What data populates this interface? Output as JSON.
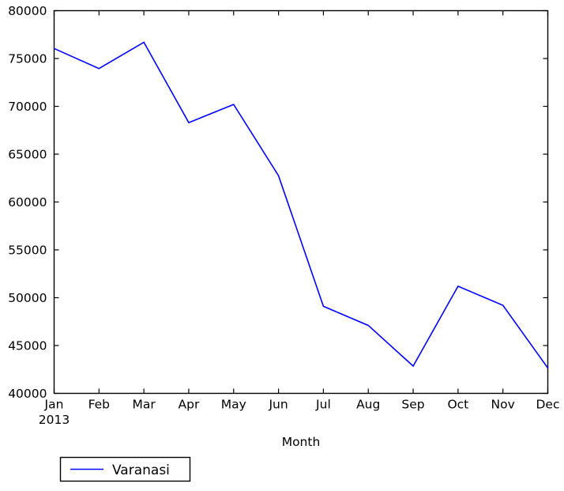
{
  "chart_data": {
    "type": "line",
    "title": "",
    "xlabel": "Month",
    "ylabel": "",
    "categories": [
      "Jan",
      "Feb",
      "Mar",
      "Apr",
      "May",
      "Jun",
      "Jul",
      "Aug",
      "Sep",
      "Oct",
      "Nov",
      "Dec"
    ],
    "x_year_label": "2013",
    "series": [
      {
        "name": "Varanasi",
        "color": "#0000ff",
        "values": [
          76050,
          73950,
          76700,
          68300,
          70200,
          62750,
          49100,
          47100,
          42850,
          51200,
          49200,
          42650
        ]
      }
    ],
    "ylim": [
      40000,
      80000
    ],
    "yticks": [
      "40000",
      "45000",
      "50000",
      "55000",
      "60000",
      "65000",
      "70000",
      "75000",
      "80000"
    ],
    "ytick_values": [
      40000,
      45000,
      50000,
      55000,
      60000,
      65000,
      70000,
      75000,
      80000
    ],
    "grid": false,
    "legend": {
      "position": "below-left",
      "entries": [
        {
          "label": "Varanasi",
          "color": "#0000ff"
        }
      ]
    }
  },
  "axes": {
    "x_axis_name": "month-axis",
    "y_axis_name": "value-axis"
  }
}
